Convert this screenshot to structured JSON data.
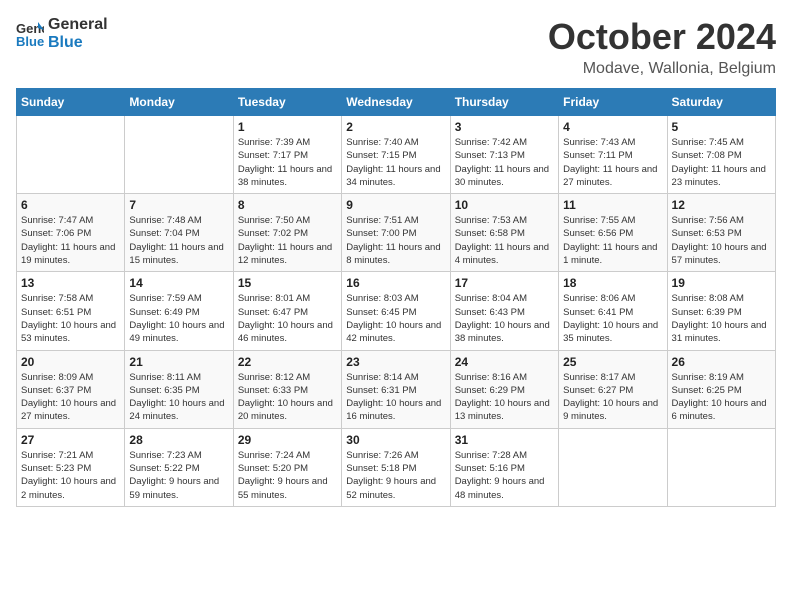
{
  "header": {
    "logo_general": "General",
    "logo_blue": "Blue",
    "month": "October 2024",
    "location": "Modave, Wallonia, Belgium"
  },
  "weekdays": [
    "Sunday",
    "Monday",
    "Tuesday",
    "Wednesday",
    "Thursday",
    "Friday",
    "Saturday"
  ],
  "weeks": [
    [
      {
        "day": "",
        "sunrise": "",
        "sunset": "",
        "daylight": ""
      },
      {
        "day": "",
        "sunrise": "",
        "sunset": "",
        "daylight": ""
      },
      {
        "day": "1",
        "sunrise": "Sunrise: 7:39 AM",
        "sunset": "Sunset: 7:17 PM",
        "daylight": "Daylight: 11 hours and 38 minutes."
      },
      {
        "day": "2",
        "sunrise": "Sunrise: 7:40 AM",
        "sunset": "Sunset: 7:15 PM",
        "daylight": "Daylight: 11 hours and 34 minutes."
      },
      {
        "day": "3",
        "sunrise": "Sunrise: 7:42 AM",
        "sunset": "Sunset: 7:13 PM",
        "daylight": "Daylight: 11 hours and 30 minutes."
      },
      {
        "day": "4",
        "sunrise": "Sunrise: 7:43 AM",
        "sunset": "Sunset: 7:11 PM",
        "daylight": "Daylight: 11 hours and 27 minutes."
      },
      {
        "day": "5",
        "sunrise": "Sunrise: 7:45 AM",
        "sunset": "Sunset: 7:08 PM",
        "daylight": "Daylight: 11 hours and 23 minutes."
      }
    ],
    [
      {
        "day": "6",
        "sunrise": "Sunrise: 7:47 AM",
        "sunset": "Sunset: 7:06 PM",
        "daylight": "Daylight: 11 hours and 19 minutes."
      },
      {
        "day": "7",
        "sunrise": "Sunrise: 7:48 AM",
        "sunset": "Sunset: 7:04 PM",
        "daylight": "Daylight: 11 hours and 15 minutes."
      },
      {
        "day": "8",
        "sunrise": "Sunrise: 7:50 AM",
        "sunset": "Sunset: 7:02 PM",
        "daylight": "Daylight: 11 hours and 12 minutes."
      },
      {
        "day": "9",
        "sunrise": "Sunrise: 7:51 AM",
        "sunset": "Sunset: 7:00 PM",
        "daylight": "Daylight: 11 hours and 8 minutes."
      },
      {
        "day": "10",
        "sunrise": "Sunrise: 7:53 AM",
        "sunset": "Sunset: 6:58 PM",
        "daylight": "Daylight: 11 hours and 4 minutes."
      },
      {
        "day": "11",
        "sunrise": "Sunrise: 7:55 AM",
        "sunset": "Sunset: 6:56 PM",
        "daylight": "Daylight: 11 hours and 1 minute."
      },
      {
        "day": "12",
        "sunrise": "Sunrise: 7:56 AM",
        "sunset": "Sunset: 6:53 PM",
        "daylight": "Daylight: 10 hours and 57 minutes."
      }
    ],
    [
      {
        "day": "13",
        "sunrise": "Sunrise: 7:58 AM",
        "sunset": "Sunset: 6:51 PM",
        "daylight": "Daylight: 10 hours and 53 minutes."
      },
      {
        "day": "14",
        "sunrise": "Sunrise: 7:59 AM",
        "sunset": "Sunset: 6:49 PM",
        "daylight": "Daylight: 10 hours and 49 minutes."
      },
      {
        "day": "15",
        "sunrise": "Sunrise: 8:01 AM",
        "sunset": "Sunset: 6:47 PM",
        "daylight": "Daylight: 10 hours and 46 minutes."
      },
      {
        "day": "16",
        "sunrise": "Sunrise: 8:03 AM",
        "sunset": "Sunset: 6:45 PM",
        "daylight": "Daylight: 10 hours and 42 minutes."
      },
      {
        "day": "17",
        "sunrise": "Sunrise: 8:04 AM",
        "sunset": "Sunset: 6:43 PM",
        "daylight": "Daylight: 10 hours and 38 minutes."
      },
      {
        "day": "18",
        "sunrise": "Sunrise: 8:06 AM",
        "sunset": "Sunset: 6:41 PM",
        "daylight": "Daylight: 10 hours and 35 minutes."
      },
      {
        "day": "19",
        "sunrise": "Sunrise: 8:08 AM",
        "sunset": "Sunset: 6:39 PM",
        "daylight": "Daylight: 10 hours and 31 minutes."
      }
    ],
    [
      {
        "day": "20",
        "sunrise": "Sunrise: 8:09 AM",
        "sunset": "Sunset: 6:37 PM",
        "daylight": "Daylight: 10 hours and 27 minutes."
      },
      {
        "day": "21",
        "sunrise": "Sunrise: 8:11 AM",
        "sunset": "Sunset: 6:35 PM",
        "daylight": "Daylight: 10 hours and 24 minutes."
      },
      {
        "day": "22",
        "sunrise": "Sunrise: 8:12 AM",
        "sunset": "Sunset: 6:33 PM",
        "daylight": "Daylight: 10 hours and 20 minutes."
      },
      {
        "day": "23",
        "sunrise": "Sunrise: 8:14 AM",
        "sunset": "Sunset: 6:31 PM",
        "daylight": "Daylight: 10 hours and 16 minutes."
      },
      {
        "day": "24",
        "sunrise": "Sunrise: 8:16 AM",
        "sunset": "Sunset: 6:29 PM",
        "daylight": "Daylight: 10 hours and 13 minutes."
      },
      {
        "day": "25",
        "sunrise": "Sunrise: 8:17 AM",
        "sunset": "Sunset: 6:27 PM",
        "daylight": "Daylight: 10 hours and 9 minutes."
      },
      {
        "day": "26",
        "sunrise": "Sunrise: 8:19 AM",
        "sunset": "Sunset: 6:25 PM",
        "daylight": "Daylight: 10 hours and 6 minutes."
      }
    ],
    [
      {
        "day": "27",
        "sunrise": "Sunrise: 7:21 AM",
        "sunset": "Sunset: 5:23 PM",
        "daylight": "Daylight: 10 hours and 2 minutes."
      },
      {
        "day": "28",
        "sunrise": "Sunrise: 7:23 AM",
        "sunset": "Sunset: 5:22 PM",
        "daylight": "Daylight: 9 hours and 59 minutes."
      },
      {
        "day": "29",
        "sunrise": "Sunrise: 7:24 AM",
        "sunset": "Sunset: 5:20 PM",
        "daylight": "Daylight: 9 hours and 55 minutes."
      },
      {
        "day": "30",
        "sunrise": "Sunrise: 7:26 AM",
        "sunset": "Sunset: 5:18 PM",
        "daylight": "Daylight: 9 hours and 52 minutes."
      },
      {
        "day": "31",
        "sunrise": "Sunrise: 7:28 AM",
        "sunset": "Sunset: 5:16 PM",
        "daylight": "Daylight: 9 hours and 48 minutes."
      },
      {
        "day": "",
        "sunrise": "",
        "sunset": "",
        "daylight": ""
      },
      {
        "day": "",
        "sunrise": "",
        "sunset": "",
        "daylight": ""
      }
    ]
  ]
}
